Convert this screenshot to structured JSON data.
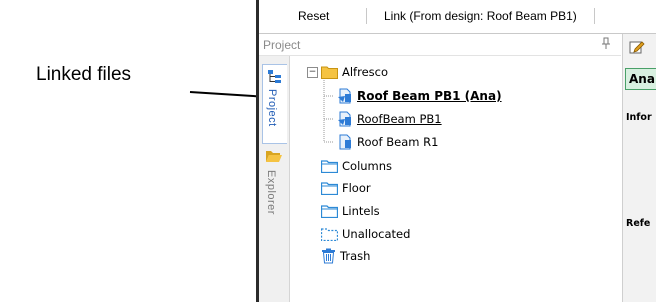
{
  "callout": {
    "text": "Linked files"
  },
  "toolbar": {
    "reset_label": "Reset",
    "link_label": "Link (From design: Roof Beam PB1)"
  },
  "project_panel": {
    "title": "Project",
    "pin_glyph": "↕"
  },
  "side_tabs": [
    {
      "label": "Project",
      "icon": "project-tree-icon",
      "active": true
    },
    {
      "label": "Explorer",
      "icon": "folder-open-icon",
      "active": false
    }
  ],
  "tree": {
    "root": {
      "label": "Alfresco",
      "expander": "−"
    },
    "children": [
      {
        "label": "Roof Beam PB1 (Ana)",
        "icon": "linked-document-icon"
      },
      {
        "label": "RoofBeam PB1",
        "icon": "linked-document-icon"
      },
      {
        "label": "Roof Beam R1",
        "icon": "document-icon"
      }
    ],
    "folders": [
      {
        "label": "Columns",
        "icon": "folder-icon"
      },
      {
        "label": "Floor",
        "icon": "folder-icon"
      },
      {
        "label": "Lintels",
        "icon": "folder-icon"
      },
      {
        "label": "Unallocated",
        "icon": "dashed-folder-icon"
      },
      {
        "label": "Trash",
        "icon": "trash-icon"
      }
    ]
  },
  "right_panel": {
    "tab_label": "Ana",
    "section_1": "Infor",
    "section_2": "Refe"
  },
  "colors": {
    "folder_yellow": "#f5c342",
    "folder_blue": "#2d8ad6",
    "doc_blue": "#2d7bd6",
    "ana_tab_bg": "#d8f0e0",
    "ana_tab_border": "#49a068"
  }
}
